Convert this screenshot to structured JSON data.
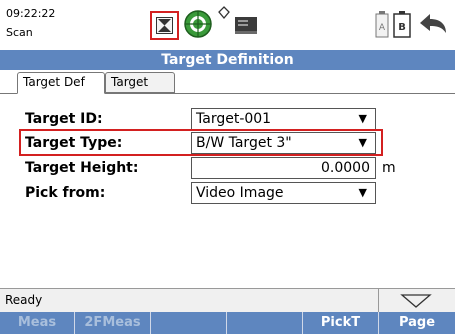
{
  "status_top": {
    "time": "09:22:22",
    "mode": "Scan",
    "battery_b_label": "B",
    "icons": [
      "close-box-icon",
      "target-green-icon",
      "diamond-icon",
      "memory-card-icon",
      "battery-a-icon",
      "battery-b-icon",
      "back-arrow-icon"
    ]
  },
  "title": "Target Definition",
  "tabs": {
    "active": "Target Def",
    "other": "Target List"
  },
  "form": {
    "target_id": {
      "label": "Target ID:",
      "value": "Target-001"
    },
    "target_type": {
      "label": "Target Type:",
      "value": "B/W Target 3\""
    },
    "target_height": {
      "label": "Target Height:",
      "value": "0.0000",
      "unit": "m"
    },
    "pick_from": {
      "label": "Pick from:",
      "value": "Video Image"
    }
  },
  "status": {
    "text": "Ready"
  },
  "softkeys": [
    {
      "label": "Meas",
      "enabled": false
    },
    {
      "label": "2FMeas",
      "enabled": false
    },
    {
      "label": "",
      "enabled": false
    },
    {
      "label": "",
      "enabled": false
    },
    {
      "label": "PickT",
      "enabled": true
    },
    {
      "label": "Page",
      "enabled": true
    }
  ],
  "colors": {
    "accent": "#5e86bf",
    "highlight": "#d32020"
  }
}
